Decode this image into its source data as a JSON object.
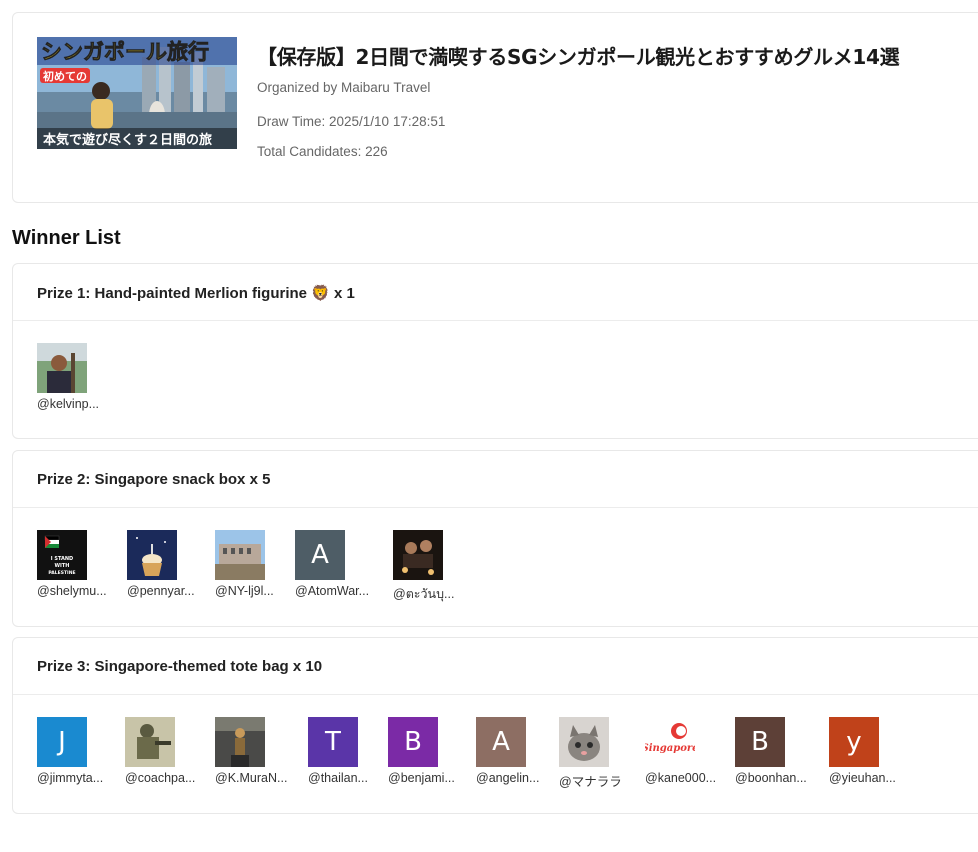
{
  "event": {
    "thumbnail": {
      "headline": "シンガポール旅行",
      "tag": "初めての",
      "caption": "本気で遊び尽くす２日間の旅"
    },
    "title": "【保存版】2日間で満喫するSGシンガポール観光とおすすめグルメ14選",
    "organizer": "Organized by Maibaru Travel",
    "draw_time": "Draw Time: 2025/1/10 17:28:51",
    "total_candidates": "Total Candidates: 226"
  },
  "winner_list_heading": "Winner List",
  "prizes": [
    {
      "title": "Prize 1: Hand-painted Merlion figurine 🦁 x 1",
      "winners": [
        {
          "username": "@kelvinp...",
          "avatar": "photo-man-outdoor"
        }
      ]
    },
    {
      "title": "Prize 2: Singapore snack box x 5",
      "winners": [
        {
          "username": "@shelymu...",
          "avatar": "photo-i-stand-with-palestine",
          "avatar_text": "I STAND WITH PALESTINE"
        },
        {
          "username": "@pennyar...",
          "avatar": "photo-cupcake"
        },
        {
          "username": "@NY-lj9l...",
          "avatar": "photo-building"
        },
        {
          "username": "@AtomWar...",
          "avatar": "letter",
          "letter": "A",
          "color": "#4e5d66"
        },
        {
          "username": "@ตะวันบุ...",
          "avatar": "photo-night-group"
        }
      ]
    },
    {
      "title": "Prize 3: Singapore-themed tote bag x 10",
      "winners": [
        {
          "username": "@jimmyta...",
          "avatar": "letter",
          "letter": "J",
          "color": "#1a8ad0"
        },
        {
          "username": "@coachpa...",
          "avatar": "photo-soldier"
        },
        {
          "username": "@K.MuraN...",
          "avatar": "photo-figure"
        },
        {
          "username": "@thailan...",
          "avatar": "letter",
          "letter": "T",
          "color": "#5a35a8"
        },
        {
          "username": "@benjami...",
          "avatar": "letter",
          "letter": "B",
          "color": "#7b2aa6"
        },
        {
          "username": "@angelin...",
          "avatar": "letter",
          "letter": "A",
          "color": "#8d6e63"
        },
        {
          "username": "@マナララ",
          "avatar": "photo-kitten"
        },
        {
          "username": "@kane000...",
          "avatar": "logo-singapore",
          "logo_text": "Singapore"
        },
        {
          "username": "@boonhan...",
          "avatar": "letter",
          "letter": "B",
          "color": "#5d4037"
        },
        {
          "username": "@yieuhan...",
          "avatar": "letter",
          "letter": "y",
          "color": "#c0421a"
        }
      ]
    }
  ]
}
